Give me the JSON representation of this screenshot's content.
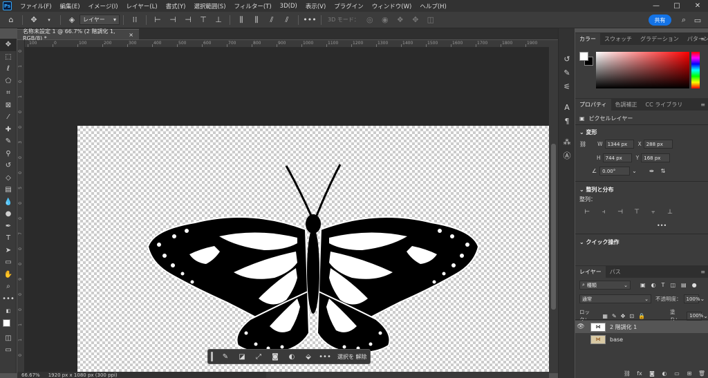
{
  "app": {
    "logo_text": "Ps"
  },
  "menu": [
    "ファイル(F)",
    "編集(E)",
    "イメージ(I)",
    "レイヤー(L)",
    "書式(Y)",
    "選択範囲(S)",
    "フィルター(T)",
    "3D(D)",
    "表示(V)",
    "プラグイン",
    "ウィンドウ(W)",
    "ヘルプ(H)"
  ],
  "window_controls": {
    "minimize": "—",
    "maximize": "□",
    "close": "✕"
  },
  "options_bar": {
    "auto_select_value": "レイヤー",
    "mode_3d_label": "3D モード：",
    "share_label": "共有"
  },
  "document": {
    "tab_title": "名称未設定 1 @ 66.7% (2 階調化 1, RGB/8) *",
    "tab_close": "×"
  },
  "ruler": {
    "top_labels": [
      "100",
      "0",
      "100",
      "200",
      "300",
      "400",
      "500",
      "600",
      "700",
      "800",
      "900",
      "1000",
      "1100",
      "1200",
      "1300",
      "1400",
      "1500",
      "1600",
      "1700",
      "1800",
      "1900",
      "2000"
    ],
    "left_labels": [
      "0",
      "1",
      "0",
      "1",
      "0",
      "0",
      "3",
      "0",
      "0",
      "5",
      "0",
      "0",
      "7",
      "0",
      "0",
      "9",
      "0",
      "0",
      "1",
      "1",
      "0"
    ]
  },
  "taskbar": {
    "deselect_label": "選択を 解除"
  },
  "status": {
    "zoom": "66.67%",
    "doc_info": "1920 px x 1080 px (300 ppi)"
  },
  "color_panel": {
    "tabs": [
      "カラー",
      "スウォッチ",
      "グラデーション",
      "パターン"
    ],
    "foreground": "#ffffff",
    "background": "#000000"
  },
  "properties_panel": {
    "tabs": [
      "プロパティ",
      "色調補正",
      "CC ライブラリ"
    ],
    "layer_type": "ピクセルレイヤー",
    "transform_heading": "変形",
    "w_label": "W",
    "w_value": "1344 px",
    "x_label": "X",
    "x_value": "288 px",
    "h_label": "H",
    "h_value": "744 px",
    "y_label": "Y",
    "y_value": "168 px",
    "angle_value": "0.00°",
    "align_heading": "整列と分布",
    "align_label": "整列：",
    "more": "•••",
    "quick_heading": "クイック操作"
  },
  "layers_panel": {
    "tabs": [
      "レイヤー",
      "パス"
    ],
    "kind_filter": "種類",
    "blend_mode": "通常",
    "opacity_label": "不透明度：",
    "opacity_value": "100%",
    "lock_label": "ロック：",
    "fill_label": "塗り：",
    "fill_value": "100%",
    "layers": [
      {
        "name": "2 階調化 1",
        "visible": true,
        "selected": true
      },
      {
        "name": "base",
        "visible": false,
        "selected": false
      }
    ],
    "footer_icons": [
      "link-icon",
      "fx-icon",
      "mask-icon",
      "adjustment-icon",
      "group-icon",
      "new-layer-icon",
      "trash-icon"
    ]
  }
}
